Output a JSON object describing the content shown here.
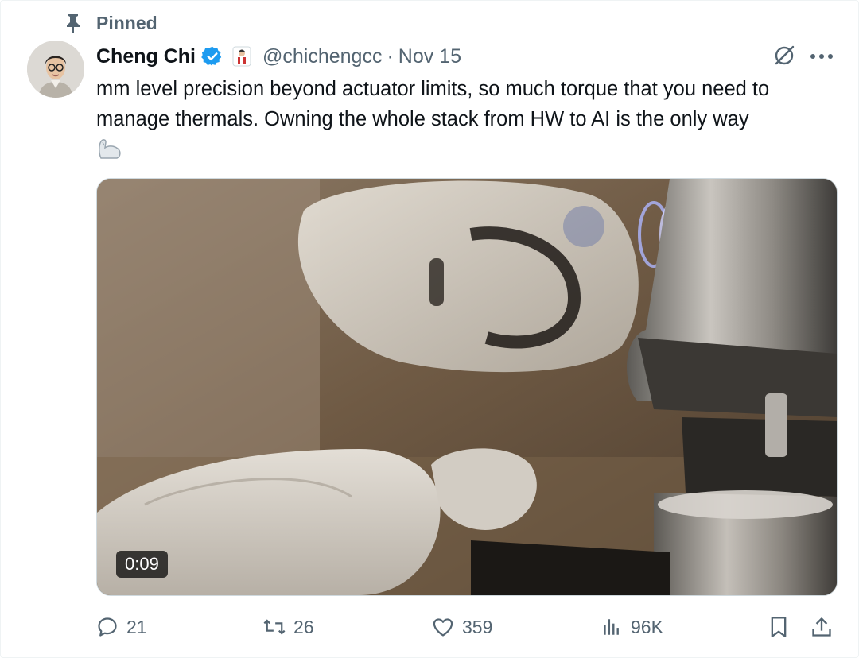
{
  "pinned": {
    "label": "Pinned",
    "icon": "pin-icon"
  },
  "author": {
    "name": "Cheng Chi",
    "handle": "@chichengcc",
    "separator": "·",
    "date": "Nov 15",
    "verified_color": "#1d9bf0"
  },
  "tweet": {
    "text": "mm level precision beyond actuator limits, so much torque that you need to manage thermals. Owning the whole stack from HW to AI is the only way",
    "trailing_emoji": "flexed-biceps-robot-arm"
  },
  "media": {
    "duration": "0:09"
  },
  "actions": {
    "replies": "21",
    "reposts": "26",
    "likes": "359",
    "views": "96K"
  },
  "colors": {
    "text": "#0f1419",
    "secondary": "#536471",
    "accent": "#1d9bf0"
  }
}
